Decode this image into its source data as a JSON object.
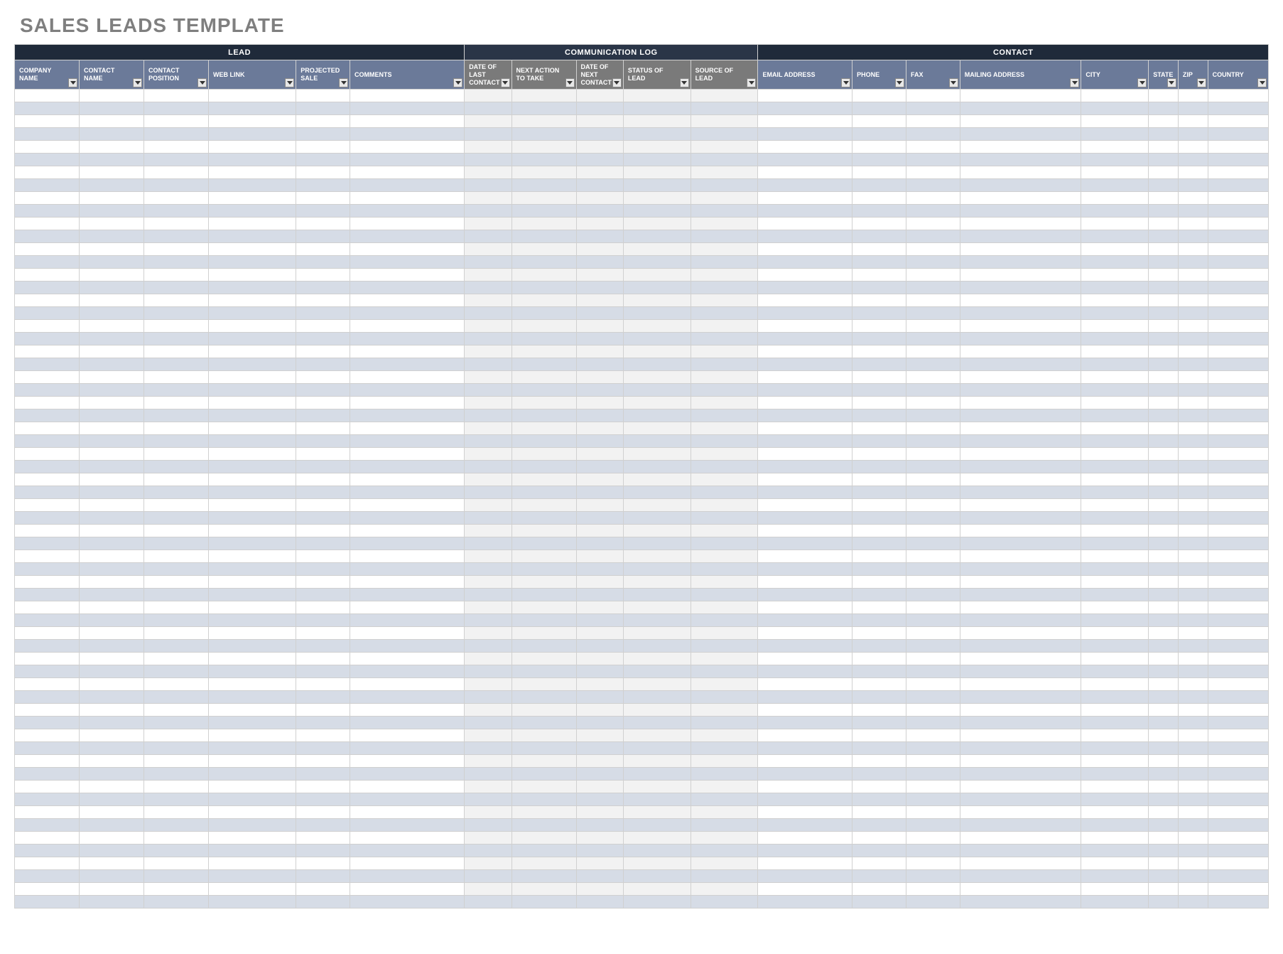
{
  "title": "SALES LEADS TEMPLATE",
  "groups": {
    "lead": "LEAD",
    "comm": "COMMUNICATION LOG",
    "contact": "CONTACT"
  },
  "columns": {
    "company_name": "COMPANY NAME",
    "contact_name": "CONTACT NAME",
    "contact_position": "CONTACT POSITION",
    "web_link": "WEB LINK",
    "projected_sale": "PROJECTED SALE",
    "comments": "COMMENTS",
    "date_last_contact": "DATE OF LAST CONTACT",
    "next_action": "NEXT ACTION TO TAKE",
    "date_next_contact": "DATE OF NEXT CONTACT",
    "status_of_lead": "STATUS OF LEAD",
    "source_of_lead": "SOURCE OF LEAD",
    "email_address": "EMAIL ADDRESS",
    "phone": "PHONE",
    "fax": "FAX",
    "mailing_address": "MAILING ADDRESS",
    "city": "CITY",
    "state": "STATE",
    "zip": "ZIP",
    "country": "COUNTRY"
  },
  "row_count": 64,
  "rows": []
}
